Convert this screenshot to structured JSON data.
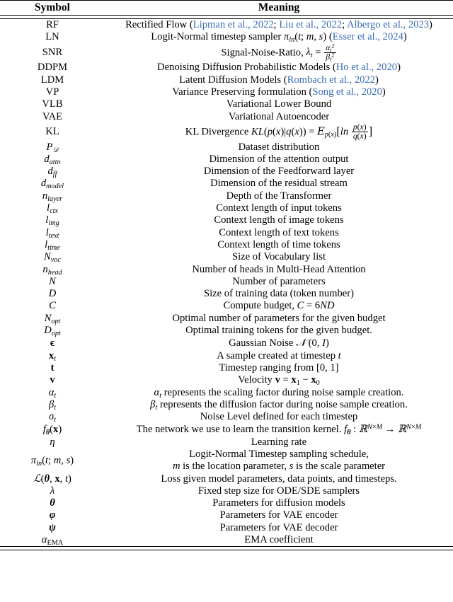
{
  "table": {
    "headers": {
      "symbol": "Symbol",
      "meaning": "Meaning"
    },
    "citation_color": "#3a6db5",
    "rows": [
      {
        "symbol": "RF",
        "meaning": "Rectified Flow (Lipman et al., 2022; Liu et al., 2022; Albergo et al., 2023)"
      },
      {
        "symbol": "LN",
        "meaning": "Logit-Normal timestep sampler πln(t; m, s) (Esser et al., 2024)"
      },
      {
        "symbol": "SNR",
        "meaning": "Signal-Noise-Ratio, λt = αt² / βt²"
      },
      {
        "symbol": "DDPM",
        "meaning": "Denoising Diffusion Probabilistic Models (Ho et al., 2020)"
      },
      {
        "symbol": "LDM",
        "meaning": "Latent Diffusion Models (Rombach et al., 2022)"
      },
      {
        "symbol": "VP",
        "meaning": "Variance Preserving formulation (Song et al., 2020)"
      },
      {
        "symbol": "VLB",
        "meaning": "Variational Lower Bound"
      },
      {
        "symbol": "VAE",
        "meaning": "Variational Autoencoder"
      },
      {
        "symbol": "KL",
        "meaning": "KL Divergence KL(p(x)|q(x)) = Ep(x)[ln p(x)/q(x)]"
      },
      {
        "symbol": "P𝒟",
        "meaning": "Dataset distribution"
      },
      {
        "symbol": "dattn",
        "meaning": "Dimension of the attention output"
      },
      {
        "symbol": "dff",
        "meaning": "Dimension of the Feedforward layer"
      },
      {
        "symbol": "dmodel",
        "meaning": "Dimension of the residual stream"
      },
      {
        "symbol": "nlayer",
        "meaning": "Depth of the Transformer"
      },
      {
        "symbol": "lctx",
        "meaning": "Context length of input tokens"
      },
      {
        "symbol": "limg",
        "meaning": "Context length of image tokens"
      },
      {
        "symbol": "ltext",
        "meaning": "Context length of text tokens"
      },
      {
        "symbol": "ltime",
        "meaning": "Context length of time tokens"
      },
      {
        "symbol": "Nvoc",
        "meaning": "Size of Vocabulary list"
      },
      {
        "symbol": "nhead",
        "meaning": "Number of heads in Multi-Head Attention"
      },
      {
        "symbol": "N",
        "meaning": "Number of parameters"
      },
      {
        "symbol": "D",
        "meaning": "Size of training data (token number)"
      },
      {
        "symbol": "C",
        "meaning": "Compute budget, C = 6ND"
      },
      {
        "symbol": "Nopt",
        "meaning": "Optimal number of parameters for the given budget"
      },
      {
        "symbol": "Dopt",
        "meaning": "Optimal training tokens for the given budget."
      },
      {
        "symbol": "ϵ",
        "meaning": "Gaussian Noise 𝒩 (0, I)"
      },
      {
        "symbol": "xt",
        "meaning": "A sample created at timestep t"
      },
      {
        "symbol": "t",
        "meaning": "Timestep ranging from [0, 1]"
      },
      {
        "symbol": "v",
        "meaning": "Velocity v = x1 − x0"
      },
      {
        "symbol": "αt",
        "meaning": "αt represents the scaling factor during noise sample creation."
      },
      {
        "symbol": "βt",
        "meaning": "βt represents the diffusion factor during noise sample creation."
      },
      {
        "symbol": "σt",
        "meaning": "Noise Level defined for each timestep"
      },
      {
        "symbol": "fθ(x)",
        "meaning": "The network we use to learn the transition kernel. fθ : ℝᴺ×ᴹ → ℝᴺ×ᴹ"
      },
      {
        "symbol": "η",
        "meaning": "Learning rate"
      },
      {
        "symbol": "πln(t; m, s)",
        "meaning": "Logit-Normal Timestep sampling schedule,",
        "meaning_line2": "m is the location parameter, s is the scale parameter"
      },
      {
        "symbol": "ℒ(θ, x, t)",
        "meaning": "Loss given model parameters, data points, and timesteps."
      },
      {
        "symbol": "λ",
        "meaning": "Fixed step size for ODE/SDE samplers"
      },
      {
        "symbol": "θ",
        "meaning": "Parameters for diffusion models"
      },
      {
        "symbol": "ϕ",
        "meaning": "Parameters for VAE encoder"
      },
      {
        "symbol": "ψ",
        "meaning": "Parameters for VAE decoder"
      },
      {
        "symbol": "αEMA",
        "meaning": "EMA coefficient"
      }
    ],
    "citations": [
      "Lipman et al., 2022",
      "Liu et al., 2022",
      "Albergo et al., 2023",
      "Esser et al., 2024",
      "Ho et al., 2020",
      "Rombach et al., 2022",
      "Song et al., 2020"
    ]
  }
}
